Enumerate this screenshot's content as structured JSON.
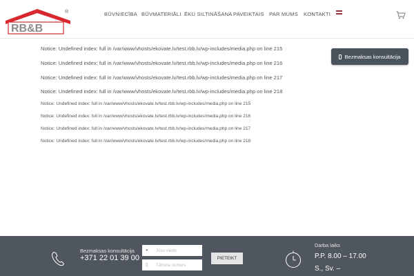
{
  "header": {
    "logo_text": "RB&B",
    "logo_registered": "®",
    "nav": [
      {
        "label": "BŪVNIECĪBA"
      },
      {
        "label": "BŪVMATERIĀLI"
      },
      {
        "label": "ĒKU SILTINĀŠANA"
      },
      {
        "label": "PAVEIKTAIS"
      },
      {
        "label": "PAR MUMS"
      },
      {
        "label": "KONTAKTI"
      }
    ],
    "language_flag": "latvia-flag",
    "cart_icon": "cart-icon"
  },
  "notices": [
    {
      "text": "Notice: Undefined index: full in /var/www/vhosts/ekovate.lv/test.rbb.lv/wp-includes/media.php on line 215"
    },
    {
      "text": "Notice: Undefined index: full in /var/www/vhosts/ekovate.lv/test.rbb.lv/wp-includes/media.php on line 216"
    },
    {
      "text": "Notice: Undefined index: full in /var/www/vhosts/ekovate.lv/test.rbb.lv/wp-includes/media.php on line 217"
    },
    {
      "text": "Notice: Undefined index: full in /var/www/vhosts/ekovate.lv/test.rbb.lv/wp-includes/media.php on line 218"
    },
    {
      "text": "Notice: Undefined index: full in /var/www/vhosts/ekovate.lv/test.rbb.lv/wp-includes/media.php on line 215"
    },
    {
      "text": "Notice: Undefined index: full in /var/www/vhosts/ekovate.lv/test.rbb.lv/wp-includes/media.php on line 216"
    },
    {
      "text": "Notice: Undefined index: full in /var/www/vhosts/ekovate.lv/test.rbb.lv/wp-includes/media.php on line 217"
    },
    {
      "text": "Notice: Undefined index: full in /var/www/vhosts/ekovate.lv/test.rbb.lv/wp-includes/media.php on line 218"
    }
  ],
  "consult_button": {
    "label": "Bezmaksas konsultācija",
    "icon": "mobile-phone-icon"
  },
  "footer": {
    "consult_label": "Bezmaksas konsultācija",
    "consult_number": "+371 22 01 39 00",
    "name_placeholder": "Jūsu vārds",
    "phone_placeholder": "Tālruņa numurs",
    "submit_label": "PIETEIKT",
    "hours_label": "Darba laiks",
    "hours_line1": "P.P. 8.00 – 17.00",
    "hours_line2": "S., Sv. –"
  },
  "colors": {
    "brand_red": "#d7282f",
    "logo_gray": "#8c8c8c",
    "footer_bg": "#4f565d",
    "button_bg": "#4a525b"
  }
}
